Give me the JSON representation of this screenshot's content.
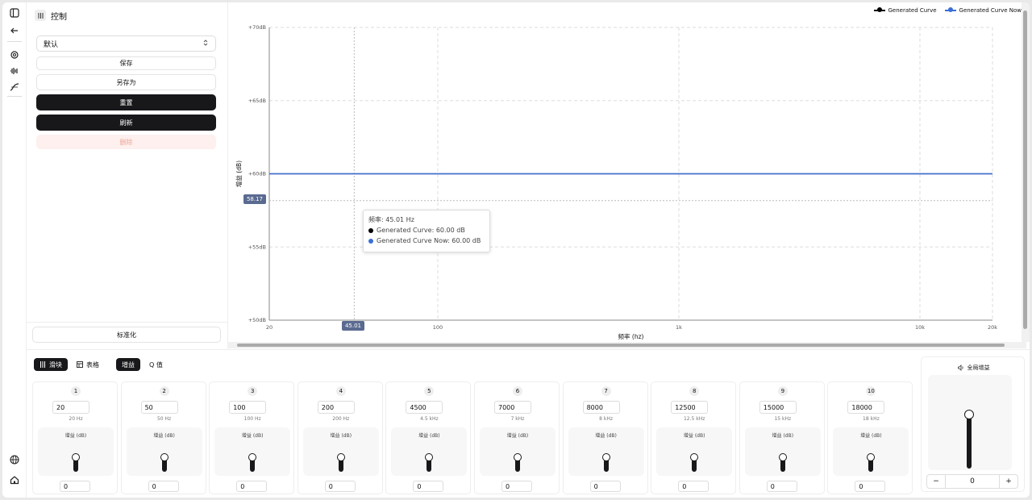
{
  "sidebar_panel": {
    "title": "控制",
    "preset_select": "默认",
    "save_label": "保存",
    "save_as_label": "另存为",
    "reset_label": "重置",
    "refresh_label": "刷新",
    "delete_label": "删除",
    "normalize_label": "标准化"
  },
  "chart_data": {
    "type": "line",
    "xlabel": "频率 (hz)",
    "ylabel": "增益 (dB)",
    "x_scale": "log",
    "xlim": [
      20,
      20000
    ],
    "ylim": [
      50,
      70
    ],
    "x_ticks": [
      {
        "v": 20,
        "label": "20"
      },
      {
        "v": 100,
        "label": "100"
      },
      {
        "v": 1000,
        "label": "1k"
      },
      {
        "v": 10000,
        "label": "10k"
      },
      {
        "v": 20000,
        "label": "20k"
      }
    ],
    "y_ticks": [
      {
        "v": 50,
        "label": "+50dB"
      },
      {
        "v": 55,
        "label": "+55dB"
      },
      {
        "v": 60,
        "label": "+60dB"
      },
      {
        "v": 65,
        "label": "+65dB"
      },
      {
        "v": 70,
        "label": "+70dB"
      }
    ],
    "x": [
      20,
      20000
    ],
    "series": [
      {
        "name": "Generated Curve",
        "values": [
          60,
          60
        ],
        "color": "#000000"
      },
      {
        "name": "Generated Curve Now",
        "values": [
          60,
          60
        ],
        "color": "#3b6fd6"
      }
    ],
    "grid": true,
    "legend": "top-right",
    "crosshair": {
      "x": 45.01,
      "y": 58.17,
      "x_label": "45.01",
      "y_label": "58.17"
    },
    "tooltip": {
      "title": "频率: 45.01 Hz",
      "lines": [
        "Generated Curve: 60.00 dB",
        "Generated Curve Now: 60.00 dB"
      ]
    }
  },
  "bottom": {
    "tabs": [
      "滑块",
      "表格"
    ],
    "mode_tabs": [
      "增益",
      "Q 值"
    ],
    "freq_unit_label": "增益 (dB)",
    "global_gain_label": "全局增益",
    "global_gain_value": "0",
    "global_gain_level": 0.62,
    "stepper_minus": "−",
    "stepper_plus": "+"
  },
  "bands": [
    {
      "index": "1",
      "freq": "20",
      "freq_label": "20 Hz",
      "gain": "0"
    },
    {
      "index": "2",
      "freq": "50",
      "freq_label": "50 Hz",
      "gain": "0"
    },
    {
      "index": "3",
      "freq": "100",
      "freq_label": "100 Hz",
      "gain": "0"
    },
    {
      "index": "4",
      "freq": "200",
      "freq_label": "200 Hz",
      "gain": "0"
    },
    {
      "index": "5",
      "freq": "4500",
      "freq_label": "4.5 kHz",
      "gain": "0"
    },
    {
      "index": "6",
      "freq": "7000",
      "freq_label": "7 kHz",
      "gain": "0"
    },
    {
      "index": "7",
      "freq": "8000",
      "freq_label": "8 kHz",
      "gain": "0"
    },
    {
      "index": "8",
      "freq": "12500",
      "freq_label": "12.5 kHz",
      "gain": "0"
    },
    {
      "index": "9",
      "freq": "15000",
      "freq_label": "15 kHz",
      "gain": "0"
    },
    {
      "index": "10",
      "freq": "18000",
      "freq_label": "18 kHz",
      "gain": "0"
    }
  ]
}
